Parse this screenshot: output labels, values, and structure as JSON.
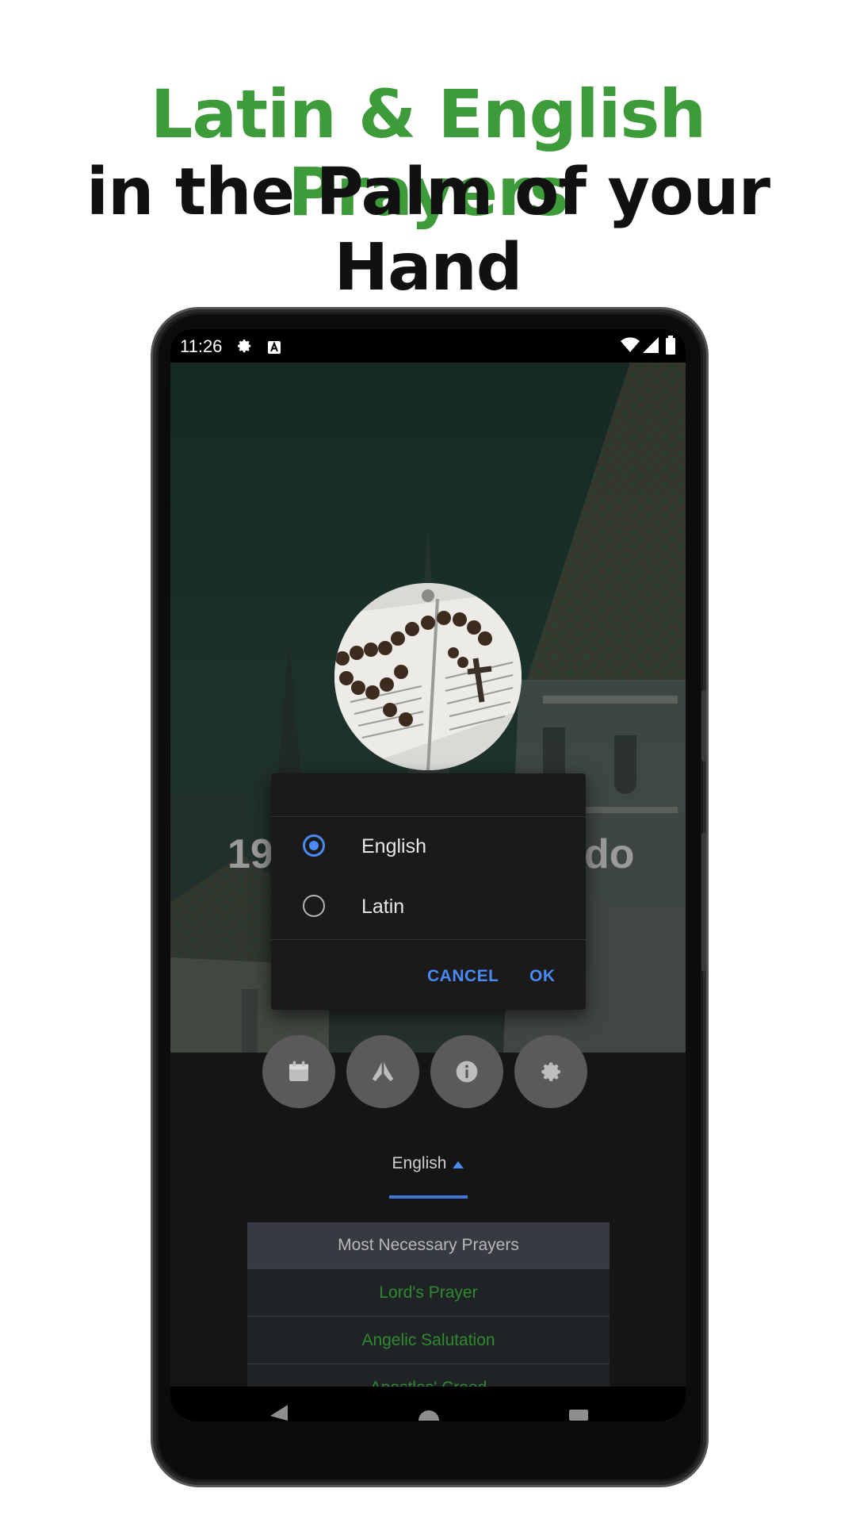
{
  "promo": {
    "title_green": "Latin & English Prayers",
    "title_black": "in the Palm of your Hand"
  },
  "status_bar": {
    "time": "11:26",
    "icons": [
      "gear-icon",
      "a-box-icon",
      "wifi-icon",
      "signal-icon",
      "battery-icon"
    ]
  },
  "hero": {
    "title_left": "19",
    "title_right": "do",
    "image": "rosary-on-open-book"
  },
  "language_dialog": {
    "options": [
      {
        "label": "English",
        "selected": true
      },
      {
        "label": "Latin",
        "selected": false
      }
    ],
    "cancel_label": "CANCEL",
    "ok_label": "OK"
  },
  "action_buttons": [
    "calendar-icon",
    "praying-hands-icon",
    "info-icon",
    "settings-icon"
  ],
  "language_tab": {
    "label": "English"
  },
  "prayer_list": {
    "header": "Most Necessary Prayers",
    "items": [
      "Lord's Prayer",
      "Angelic Salutation",
      "Apostles' Creed"
    ]
  },
  "colors": {
    "accent_green": "#3e9b3a",
    "accent_blue": "#4a8af4",
    "link_green": "#2e8a2e"
  }
}
